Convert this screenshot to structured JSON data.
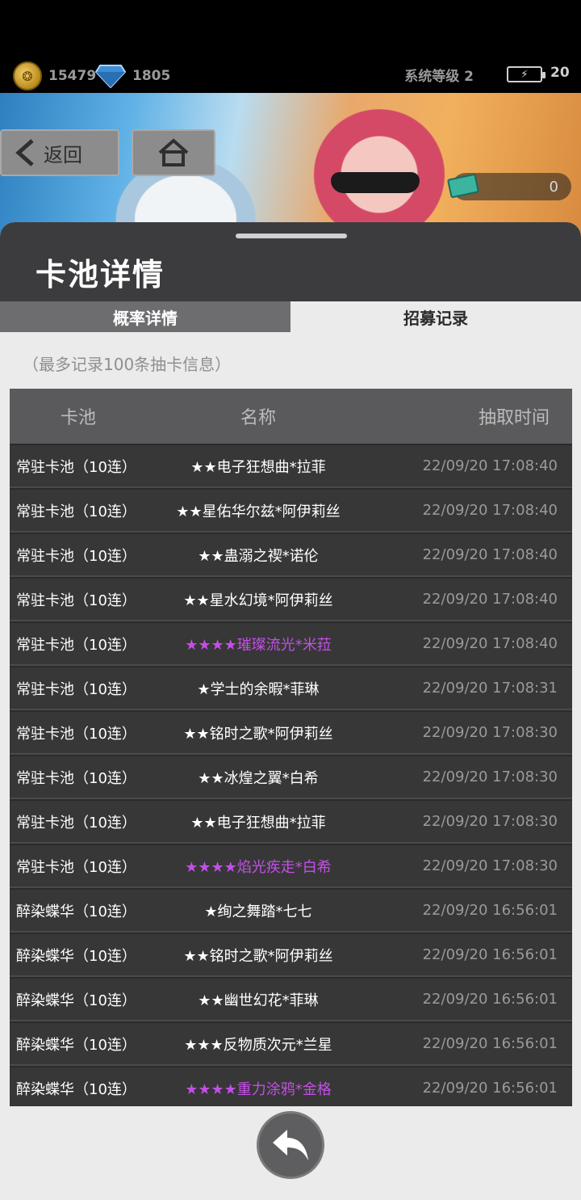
{
  "topbar": {
    "coins": "15479",
    "gems": "1805",
    "system_level": "系统等级 2",
    "battery_value": "20"
  },
  "banner": {
    "back_label": "返回",
    "counter": "0"
  },
  "panel": {
    "title": "卡池详情",
    "tabs": [
      "概率详情",
      "招募记录"
    ],
    "active_tab": "招募记录",
    "note": "（最多记录100条抽卡信息）"
  },
  "table": {
    "headers": {
      "pool": "卡池",
      "name": "名称",
      "time": "抽取时间"
    },
    "rows": [
      {
        "pool": "常驻卡池（10连）",
        "name": "★★电子狂想曲*拉菲",
        "time": "22/09/20 17:08:40",
        "rare": false
      },
      {
        "pool": "常驻卡池（10连）",
        "name": "★★星佑华尔兹*阿伊莉丝",
        "time": "22/09/20 17:08:40",
        "rare": false
      },
      {
        "pool": "常驻卡池（10连）",
        "name": "★★蛊溺之禊*诺伦",
        "time": "22/09/20 17:08:40",
        "rare": false
      },
      {
        "pool": "常驻卡池（10连）",
        "name": "★★星水幻境*阿伊莉丝",
        "time": "22/09/20 17:08:40",
        "rare": false
      },
      {
        "pool": "常驻卡池（10连）",
        "name": "★★★★璀璨流光*米菈",
        "time": "22/09/20 17:08:40",
        "rare": true
      },
      {
        "pool": "常驻卡池（10连）",
        "name": "★学士的余暇*菲琳",
        "time": "22/09/20 17:08:31",
        "rare": false
      },
      {
        "pool": "常驻卡池（10连）",
        "name": "★★铭时之歌*阿伊莉丝",
        "time": "22/09/20 17:08:30",
        "rare": false
      },
      {
        "pool": "常驻卡池（10连）",
        "name": "★★冰煌之翼*白希",
        "time": "22/09/20 17:08:30",
        "rare": false
      },
      {
        "pool": "常驻卡池（10连）",
        "name": "★★电子狂想曲*拉菲",
        "time": "22/09/20 17:08:30",
        "rare": false
      },
      {
        "pool": "常驻卡池（10连）",
        "name": "★★★★焰光疾走*白希",
        "time": "22/09/20 17:08:30",
        "rare": true
      },
      {
        "pool": "醉染蝶华（10连）",
        "name": "★绚之舞踏*七七",
        "time": "22/09/20 16:56:01",
        "rare": false
      },
      {
        "pool": "醉染蝶华（10连）",
        "name": "★★铭时之歌*阿伊莉丝",
        "time": "22/09/20 16:56:01",
        "rare": false
      },
      {
        "pool": "醉染蝶华（10连）",
        "name": "★★幽世幻花*菲琳",
        "time": "22/09/20 16:56:01",
        "rare": false
      },
      {
        "pool": "醉染蝶华（10连）",
        "name": "★★★反物质次元*兰星",
        "time": "22/09/20 16:56:01",
        "rare": false
      },
      {
        "pool": "醉染蝶华（10连）",
        "name": "★★★★重力涂鸦*金格",
        "time": "22/09/20 16:56:01",
        "rare": true
      }
    ]
  },
  "colors": {
    "rare_name": "#c34fe7",
    "panel_bg": "#ebebeb",
    "header_bg": "#3c3c3f"
  },
  "icons": [
    "coin-icon",
    "gem-icon",
    "battery-icon",
    "back-arrow-icon",
    "home-icon",
    "ticket-icon",
    "return-icon"
  ]
}
